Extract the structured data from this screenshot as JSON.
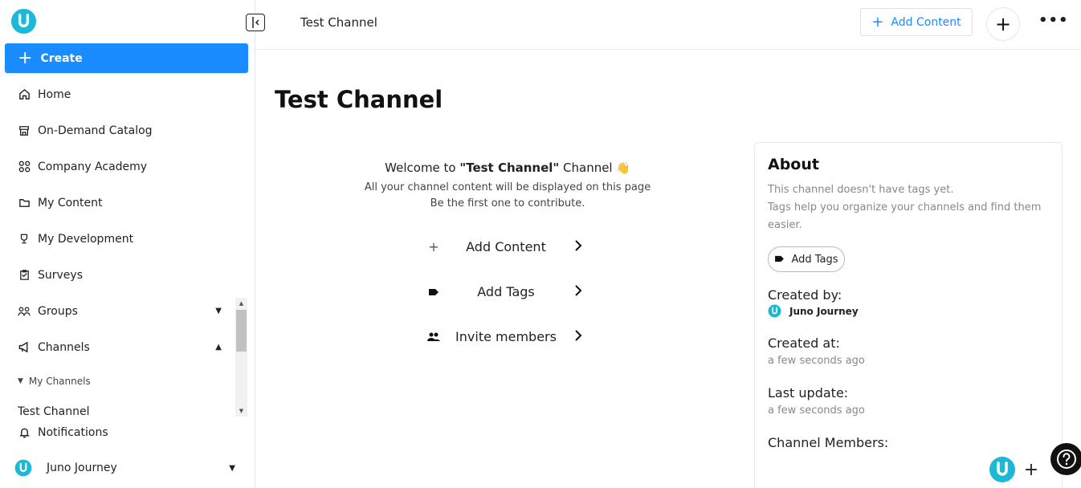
{
  "sidebar": {
    "create_label": "Create",
    "items": [
      {
        "label": "Home",
        "icon": "home-icon"
      },
      {
        "label": "On-Demand Catalog",
        "icon": "storefront-icon"
      },
      {
        "label": "Company Academy",
        "icon": "apps-icon"
      },
      {
        "label": "My Content",
        "icon": "folder-icon"
      },
      {
        "label": "My Development",
        "icon": "trophy-icon"
      },
      {
        "label": "Surveys",
        "icon": "clipboard-icon"
      },
      {
        "label": "Groups",
        "icon": "group-icon"
      },
      {
        "label": "Channels",
        "icon": "megaphone-icon"
      }
    ],
    "my_channels_label": "My Channels",
    "channel_item": "Test Channel",
    "notifications_label": "Notifications",
    "user_name": "Juno Journey"
  },
  "topbar": {
    "title": "Test Channel",
    "add_content_label": "Add Content"
  },
  "main": {
    "title": "Test Channel",
    "welcome_prefix": "Welcome to ",
    "welcome_channel": "\"Test Channel\"",
    "welcome_suffix": " Channel",
    "welcome_emoji": "👋",
    "subtitle_1": "All your channel content will be displayed on this page",
    "subtitle_2": "Be the first one to contribute.",
    "actions": [
      {
        "label": "Add Content",
        "icon": "plus-icon"
      },
      {
        "label": "Add Tags",
        "icon": "tag-icon"
      },
      {
        "label": "Invite members",
        "icon": "people-icon"
      }
    ]
  },
  "about": {
    "title": "About",
    "desc_1": "This channel doesn't have tags yet.",
    "desc_2": "Tags help you organize your channels and find them easier.",
    "add_tags_label": "Add Tags",
    "created_by_label": "Created by:",
    "created_by_value": "Juno Journey",
    "created_at_label": "Created at:",
    "created_at_value": "a few seconds ago",
    "last_update_label": "Last update:",
    "last_update_value": "a few seconds ago",
    "members_label": "Channel Members:"
  },
  "colors": {
    "accent": "#1a8cff",
    "logo": "#1cb8d6"
  }
}
